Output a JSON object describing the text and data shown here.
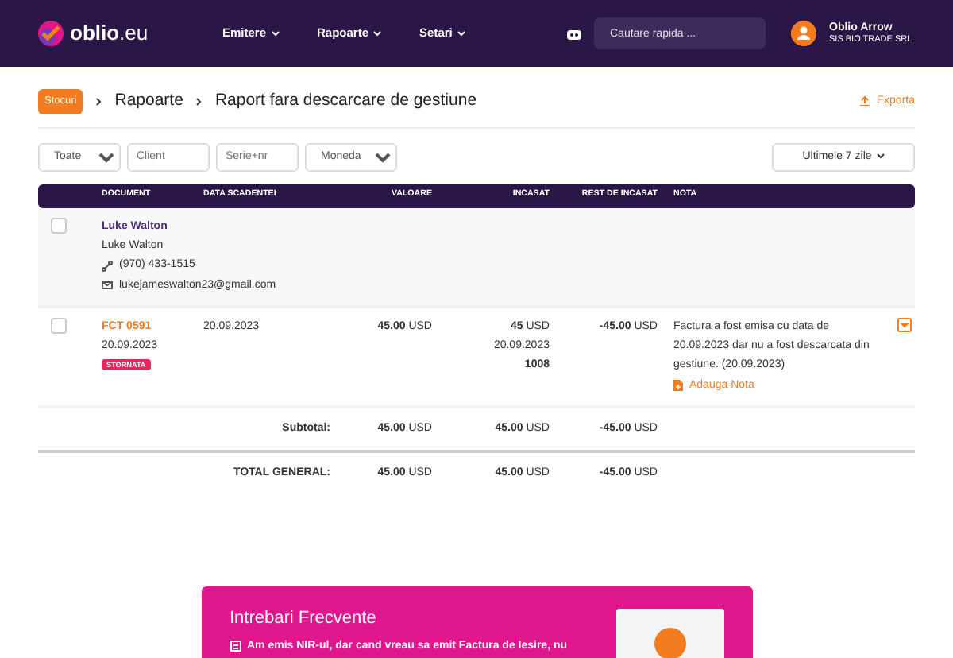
{
  "navbar": {
    "logo": "oblio",
    "logo_suffix": ".eu",
    "menu": [
      {
        "label": "Emitere"
      },
      {
        "label": "Rapoarte"
      },
      {
        "label": "Setari"
      }
    ],
    "search": {
      "placeholder": "Cautare rapida ..."
    },
    "user": {
      "name": "Oblio Arrow",
      "company": "SIS BIO TRADE SRL"
    }
  },
  "breadcrumb": {
    "badge": "Stocuri",
    "items": [
      "Rapoarte",
      "Raport fara descarcare de gestiune"
    ],
    "export": "Exporta"
  },
  "filters": {
    "status": "Toate",
    "client_placeholder": "Client",
    "series_placeholder": "Serie+nr",
    "currency": "Moneda",
    "period": "Ultimele 7 zile"
  },
  "table": {
    "columns": [
      "DOCUMENT",
      "DATA SCADENTEI",
      "VALOARE",
      "INCASAT",
      "REST DE INCASAT",
      "NOTA"
    ],
    "client": {
      "checked": false,
      "name": "Luke Walton",
      "contact": "Luke Walton",
      "phone": "(970) 433-1515",
      "email": "lukejameswalton23@gmail.com"
    },
    "rows": [
      {
        "checked": false,
        "doc": "FCT 0591",
        "doc_date": "20.09.2023",
        "tag": "STORNATA",
        "due": "20.09.2023",
        "value": "45.00",
        "value_cur": "USD",
        "paid": "45",
        "paid_cur": "USD",
        "paid_date": "20.09.2023",
        "paid_ref": "1008",
        "rest": "-45.00",
        "rest_cur": "USD",
        "note": "Factura a fost emisa cu data de 20.09.2023 dar nu a fost descarcata din gestiune. (20.09.2023)",
        "add_note": "Adauga Nota"
      }
    ],
    "totals": [
      {
        "label": "Subtotal:",
        "value": "45.00",
        "value_cur": "USD",
        "paid": "45.00",
        "paid_cur": "USD",
        "rest": "-45.00",
        "rest_cur": "USD"
      },
      {
        "label": "TOTAL GENERAL:",
        "value": "45.00",
        "value_cur": "USD",
        "paid": "45.00",
        "paid_cur": "USD",
        "rest": "-45.00",
        "rest_cur": "USD"
      }
    ]
  },
  "faq": {
    "title": "Intrebari Frecvente",
    "item": "Am emis NIR-ul, dar cand vreau sa emit Factura de Iesire, nu"
  }
}
